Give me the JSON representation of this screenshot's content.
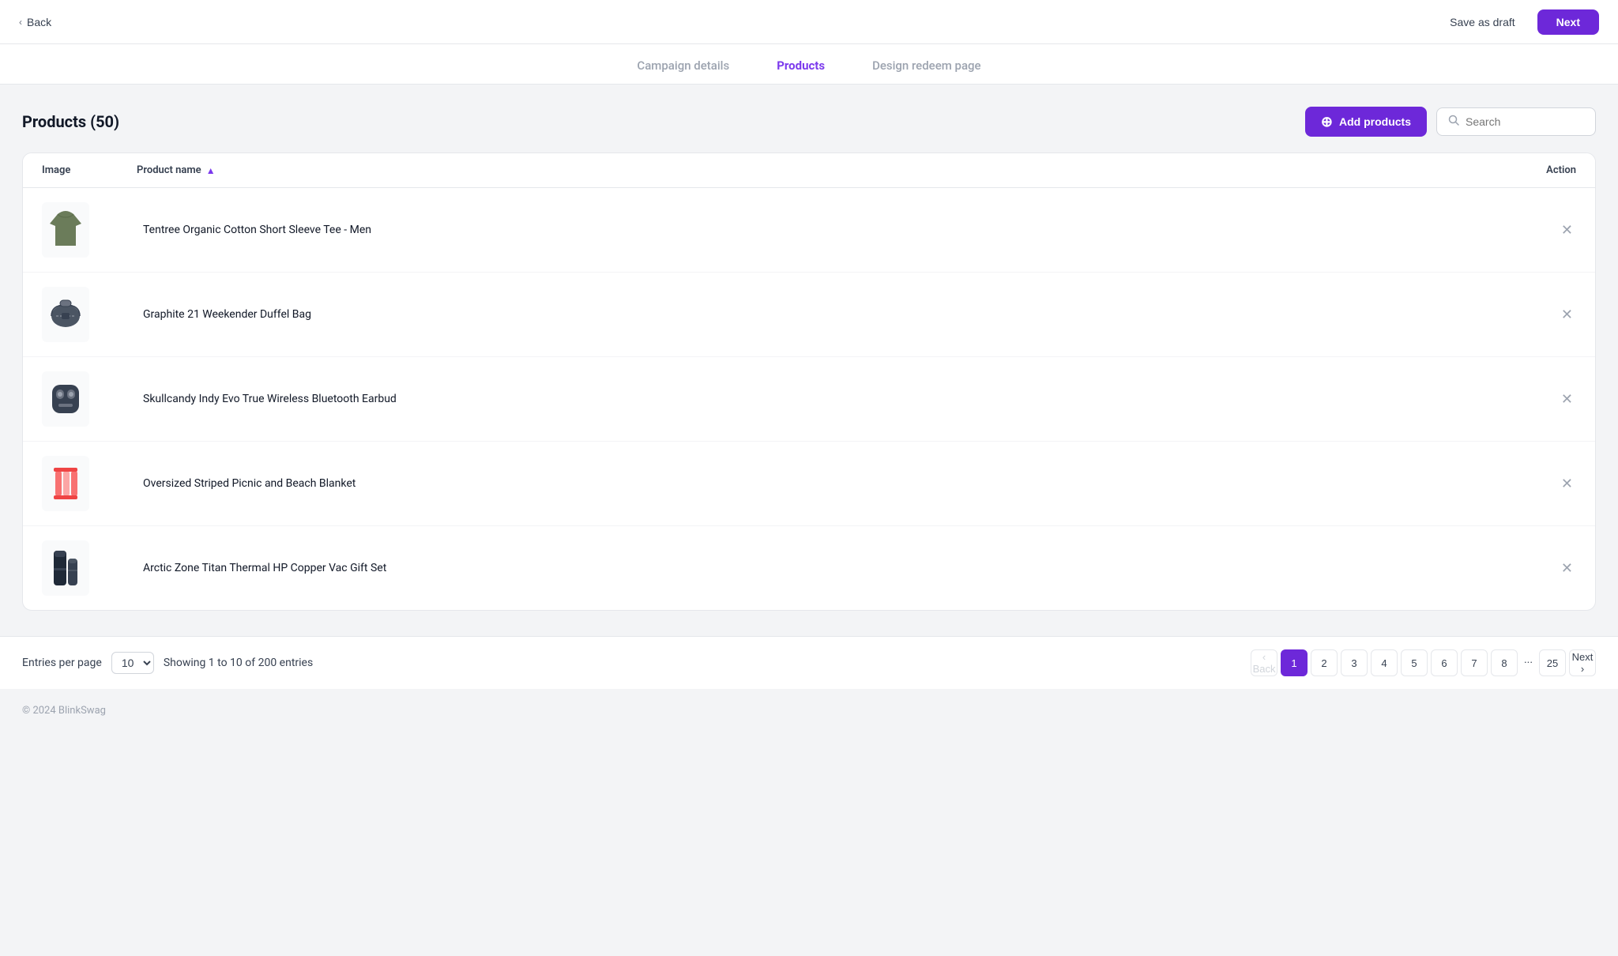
{
  "topBar": {
    "back_label": "Back",
    "save_draft_label": "Save as draft",
    "next_label": "Next"
  },
  "steps": [
    {
      "id": "campaign-details",
      "label": "Campaign details",
      "state": "inactive"
    },
    {
      "id": "products",
      "label": "Products",
      "state": "active"
    },
    {
      "id": "design-redeem-page",
      "label": "Design redeem page",
      "state": "inactive"
    }
  ],
  "productsSection": {
    "title": "Products (50)",
    "add_products_label": "Add products",
    "search_placeholder": "Search"
  },
  "table": {
    "columns": {
      "image": "Image",
      "product_name": "Product name",
      "action": "Action"
    },
    "rows": [
      {
        "id": 1,
        "name": "Tentree Organic Cotton Short Sleeve Tee - Men",
        "color": "#6b7c5a",
        "type": "tshirt"
      },
      {
        "id": 2,
        "name": "Graphite 21 Weekender Duffel Bag",
        "color": "#4b5563",
        "type": "bag"
      },
      {
        "id": 3,
        "name": "Skullcandy Indy Evo True Wireless Bluetooth Earbud",
        "color": "#374151",
        "type": "earbuds"
      },
      {
        "id": 4,
        "name": "Oversized Striped Picnic and Beach Blanket",
        "color": "#f87171",
        "type": "blanket"
      },
      {
        "id": 5,
        "name": "Arctic Zone Titan Thermal HP Copper Vac Gift Set",
        "color": "#1f2937",
        "type": "thermos"
      }
    ]
  },
  "pagination": {
    "entries_per_page_label": "Entries per page",
    "entries_per_page_value": "10",
    "showing_text": "Showing 1 to 10 of 200 entries",
    "back_label": "‹ Back",
    "next_label": "Next ›",
    "pages": [
      "1",
      "2",
      "3",
      "4",
      "5",
      "6",
      "7",
      "8",
      "25"
    ],
    "current_page": "1",
    "dots": "···"
  },
  "footer": {
    "copyright": "© 2024 BlinkSwag"
  }
}
